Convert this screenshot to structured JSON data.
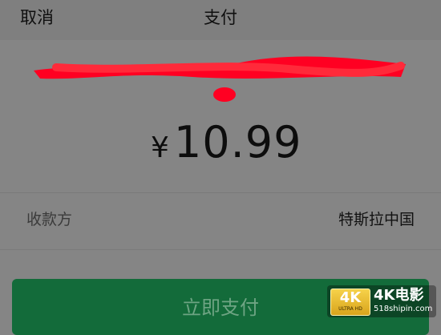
{
  "header": {
    "cancel_label": "取消",
    "title": "支付"
  },
  "payment": {
    "currency_symbol": "¥",
    "amount": "10.99"
  },
  "payee": {
    "label": "收款方",
    "value": "特斯拉中国"
  },
  "actions": {
    "pay_label": "立即支付"
  },
  "watermark": {
    "badge_big": "4K",
    "badge_small": "ULTRA HD",
    "title": "4K电影",
    "url": "518shipin.com"
  },
  "colors": {
    "overlay": "#858585",
    "button_bg": "#136b3a",
    "button_text": "#6ea483",
    "redaction": "#ff0022"
  }
}
